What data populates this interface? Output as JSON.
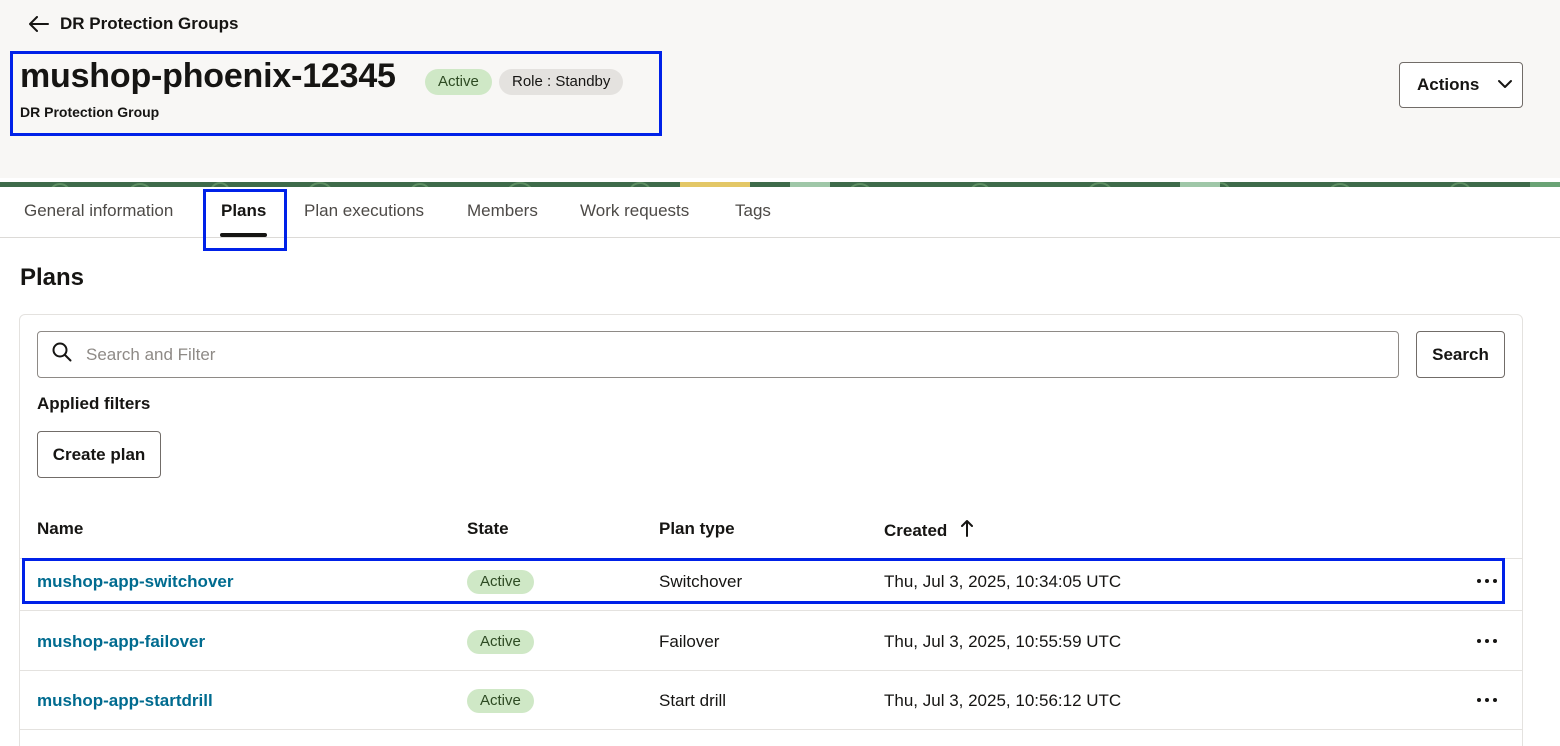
{
  "header": {
    "back_label": "DR Protection Groups",
    "title": "mushop-phoenix-12345",
    "status_badge": "Active",
    "role_badge": "Role : Standby",
    "subtitle": "DR Protection Group",
    "actions_label": "Actions"
  },
  "tabs": [
    {
      "label": "General information",
      "active": false
    },
    {
      "label": "Plans",
      "active": true
    },
    {
      "label": "Plan executions",
      "active": false
    },
    {
      "label": "Members",
      "active": false
    },
    {
      "label": "Work requests",
      "active": false
    },
    {
      "label": "Tags",
      "active": false
    }
  ],
  "section": {
    "title": "Plans",
    "search_placeholder": "Search and Filter",
    "search_value": "",
    "search_button": "Search",
    "applied_filters": "Applied filters",
    "create_button": "Create plan"
  },
  "table": {
    "columns": [
      "Name",
      "State",
      "Plan type",
      "Created"
    ],
    "sort_indicator": "↑",
    "rows": [
      {
        "name": "mushop-app-switchover",
        "state": "Active",
        "plan_type": "Switchover",
        "created": "Thu, Jul 3, 2025, 10:34:05 UTC"
      },
      {
        "name": "mushop-app-failover",
        "state": "Active",
        "plan_type": "Failover",
        "created": "Thu, Jul 3, 2025, 10:55:59 UTC"
      },
      {
        "name": "mushop-app-startdrill",
        "state": "Active",
        "plan_type": "Start drill",
        "created": "Thu, Jul 3, 2025, 10:56:12 UTC"
      }
    ]
  },
  "colors": {
    "accent_link": "#006b8f",
    "highlight_box": "#0021e8",
    "active_badge_bg": "#cfe8c6",
    "banner_green": "#3e6b4a"
  },
  "icons": {
    "back": "arrow-left-icon",
    "actions": "chevron-down-icon",
    "search": "search-icon",
    "sort": "arrow-up-icon",
    "row_menu": "more-horizontal-icon"
  }
}
